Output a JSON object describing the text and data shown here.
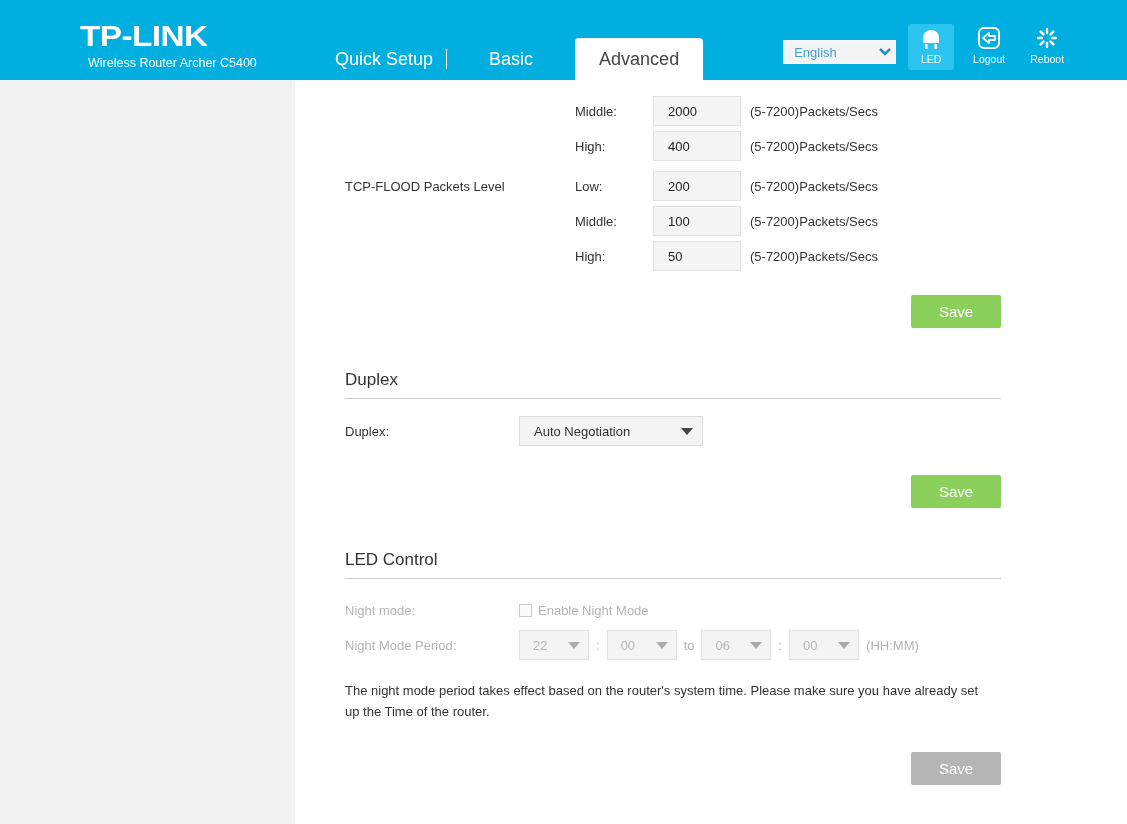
{
  "header": {
    "logo": "TP-LINK",
    "model": "Wireless Router Archer C5400",
    "tabs": [
      {
        "label": "Quick Setup",
        "selected": false
      },
      {
        "label": "Basic",
        "selected": false
      },
      {
        "label": "Advanced",
        "selected": true
      }
    ],
    "language": "English",
    "buttons": [
      {
        "label": "LED",
        "kind": "led",
        "on": true
      },
      {
        "label": "Logout",
        "kind": "logout",
        "on": false
      },
      {
        "label": "Reboot",
        "kind": "reboot",
        "on": false
      }
    ]
  },
  "flood": {
    "groups": [
      {
        "rows": [
          {
            "label": "Middle:",
            "value": "2000",
            "unit": "(5-7200)Packets/Secs"
          },
          {
            "label": "High:",
            "value": "400",
            "unit": "(5-7200)Packets/Secs"
          }
        ]
      },
      {
        "label": "TCP-FLOOD Packets Level",
        "rows": [
          {
            "label": "Low:",
            "value": "200",
            "unit": "(5-7200)Packets/Secs"
          },
          {
            "label": "Middle:",
            "value": "100",
            "unit": "(5-7200)Packets/Secs"
          },
          {
            "label": "High:",
            "value": "50",
            "unit": "(5-7200)Packets/Secs"
          }
        ]
      }
    ],
    "save": {
      "label": "Save",
      "disabled": false
    }
  },
  "duplex": {
    "title": "Duplex",
    "label": "Duplex:",
    "value": "Auto Negotiation",
    "save": {
      "label": "Save",
      "disabled": false
    }
  },
  "led_control": {
    "title": "LED Control",
    "disabled": true,
    "night_mode": {
      "label": "Night mode:",
      "checkbox": "Enable Night Mode",
      "checked": false
    },
    "period": {
      "label": "Night Mode Period:",
      "parts": [
        {
          "kind": "select",
          "value": "22"
        },
        {
          "kind": "text",
          "text": ":"
        },
        {
          "kind": "select",
          "value": "00"
        },
        {
          "kind": "text",
          "text": "to"
        },
        {
          "kind": "select",
          "value": "06"
        },
        {
          "kind": "text",
          "text": ":"
        },
        {
          "kind": "select",
          "value": "00"
        },
        {
          "kind": "text",
          "text": "(HH:MM)"
        }
      ]
    },
    "note": "The night mode period takes effect based on the router's system time. Please make sure you have already set up the Time of the router.",
    "save": {
      "label": "Save",
      "disabled": true
    }
  }
}
